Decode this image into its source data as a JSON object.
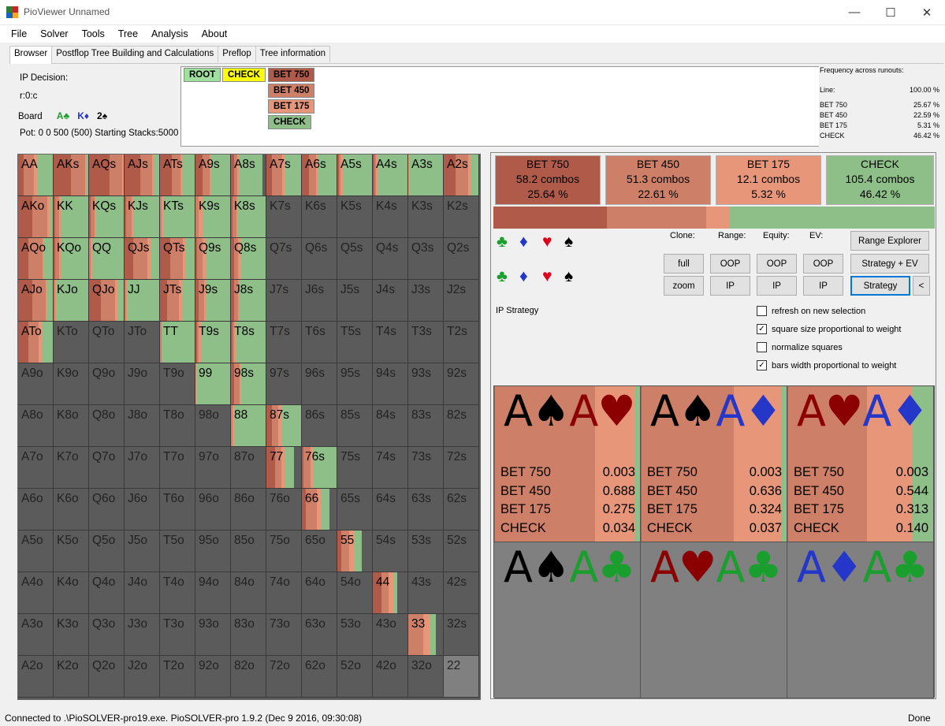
{
  "window": {
    "title": "PioViewer Unnamed"
  },
  "menu": [
    "File",
    "Solver",
    "Tools",
    "Tree",
    "Analysis",
    "About"
  ],
  "tabs": [
    "Browser",
    "Postflop Tree Building and Calculations",
    "Preflop",
    "Tree information"
  ],
  "info": {
    "decision": "IP Decision:",
    "node": "r:0:c",
    "board_label": "Board",
    "board": [
      {
        "text": "A♣",
        "color": "#1a9e2e"
      },
      {
        "text": "K♦",
        "color": "#2437c9"
      },
      {
        "text": "2♠",
        "color": "#000000"
      }
    ],
    "pot": "Pot: 0 0 500 (500) Starting Stacks:5000"
  },
  "tree": {
    "root": "ROOT",
    "check": "CHECK",
    "actions": [
      "BET 750",
      "BET 450",
      "BET 175",
      "CHECK"
    ]
  },
  "freq_panel": {
    "title": "Frequency across runouts:",
    "line_label": "Line:",
    "line_value": "100.00 %",
    "rows": [
      {
        "label": "BET 750",
        "value": "25.67 %"
      },
      {
        "label": "BET 450",
        "value": "22.59 %"
      },
      {
        "label": "BET 175",
        "value": "5.31 %"
      },
      {
        "label": "CHECK",
        "value": "46.42 %"
      }
    ]
  },
  "colors": {
    "bet750": "#b05a4a",
    "bet450": "#cd7f68",
    "bet175": "#e8967a",
    "check": "#8fbf88",
    "dead": "#5b5b5b",
    "dead2": "#808080"
  },
  "hands": [
    [
      "AA",
      "AKs",
      "AQs",
      "AJs",
      "ATs",
      "A9s",
      "A8s",
      "A7s",
      "A6s",
      "A5s",
      "A4s",
      "A3s",
      "A2s"
    ],
    [
      "AKo",
      "KK",
      "KQs",
      "KJs",
      "KTs",
      "K9s",
      "K8s",
      "K7s",
      "K6s",
      "K5s",
      "K4s",
      "K3s",
      "K2s"
    ],
    [
      "AQo",
      "KQo",
      "QQ",
      "QJs",
      "QTs",
      "Q9s",
      "Q8s",
      "Q7s",
      "Q6s",
      "Q5s",
      "Q4s",
      "Q3s",
      "Q2s"
    ],
    [
      "AJo",
      "KJo",
      "QJo",
      "JJ",
      "JTs",
      "J9s",
      "J8s",
      "J7s",
      "J6s",
      "J5s",
      "J4s",
      "J3s",
      "J2s"
    ],
    [
      "ATo",
      "KTo",
      "QTo",
      "JTo",
      "TT",
      "T9s",
      "T8s",
      "T7s",
      "T6s",
      "T5s",
      "T4s",
      "T3s",
      "T2s"
    ],
    [
      "A9o",
      "K9o",
      "Q9o",
      "J9o",
      "T9o",
      "99",
      "98s",
      "97s",
      "96s",
      "95s",
      "94s",
      "93s",
      "92s"
    ],
    [
      "A8o",
      "K8o",
      "Q8o",
      "J8o",
      "T8o",
      "98o",
      "88",
      "87s",
      "86s",
      "85s",
      "84s",
      "83s",
      "82s"
    ],
    [
      "A7o",
      "K7o",
      "Q7o",
      "J7o",
      "T7o",
      "97o",
      "87o",
      "77",
      "76s",
      "75s",
      "74s",
      "73s",
      "72s"
    ],
    [
      "A6o",
      "K6o",
      "Q6o",
      "J6o",
      "T6o",
      "96o",
      "86o",
      "76o",
      "66",
      "65s",
      "64s",
      "63s",
      "62s"
    ],
    [
      "A5o",
      "K5o",
      "Q5o",
      "J5o",
      "T5o",
      "95o",
      "85o",
      "75o",
      "65o",
      "55",
      "54s",
      "53s",
      "52s"
    ],
    [
      "A4o",
      "K4o",
      "Q4o",
      "J4o",
      "T4o",
      "94o",
      "84o",
      "74o",
      "64o",
      "54o",
      "44",
      "43s",
      "42s"
    ],
    [
      "A3o",
      "K3o",
      "Q3o",
      "J3o",
      "T3o",
      "93o",
      "83o",
      "73o",
      "63o",
      "53o",
      "43o",
      "33",
      "32s"
    ],
    [
      "A2o",
      "K2o",
      "Q2o",
      "J2o",
      "T2o",
      "92o",
      "82o",
      "72o",
      "62o",
      "52o",
      "42o",
      "32o",
      "22"
    ]
  ],
  "hand_strategy": {
    "AA": [
      0.15,
      0.3,
      0.1,
      0.45
    ],
    "AKs": [
      0.5,
      0.4,
      0.05,
      0.05
    ],
    "AQs": [
      0.6,
      0.35,
      0.05,
      0.0
    ],
    "AJs": [
      0.45,
      0.35,
      0.05,
      0.15
    ],
    "ATs": [
      0.35,
      0.25,
      0.05,
      0.35
    ],
    "A9s": [
      0.2,
      0.2,
      0.05,
      0.55
    ],
    "A8s": [
      0.1,
      0.1,
      0.05,
      0.75
    ],
    "A7s": [
      0.15,
      0.3,
      0.1,
      0.45
    ],
    "A6s": [
      0.2,
      0.2,
      0.05,
      0.55
    ],
    "A5s": [
      0.05,
      0.05,
      0.05,
      0.85
    ],
    "A4s": [
      0.05,
      0.05,
      0.05,
      0.85
    ],
    "A3s": [
      0.0,
      0.0,
      0.05,
      0.95
    ],
    "A2s": [
      0.35,
      0.35,
      0.1,
      0.2
    ],
    "AKo": [
      0.4,
      0.45,
      0.05,
      0.1
    ],
    "KK": [
      0.05,
      0.1,
      0.05,
      0.8
    ],
    "KQs": [
      0.05,
      0.1,
      0.05,
      0.8
    ],
    "KJs": [
      0.05,
      0.15,
      0.05,
      0.75
    ],
    "KTs": [
      0.0,
      0.05,
      0.05,
      0.9
    ],
    "K9s": [
      0.0,
      0.1,
      0.1,
      0.8
    ],
    "K8s": [
      0.05,
      0.1,
      0.05,
      0.8
    ],
    "AQo": [
      0.3,
      0.4,
      0.05,
      0.25
    ],
    "KQo": [
      0.05,
      0.1,
      0.05,
      0.8
    ],
    "QQ": [
      0.0,
      0.05,
      0.05,
      0.9
    ],
    "QJs": [
      0.25,
      0.4,
      0.1,
      0.25
    ],
    "QTs": [
      0.3,
      0.35,
      0.1,
      0.25
    ],
    "Q9s": [
      0.05,
      0.15,
      0.1,
      0.7
    ],
    "Q8s": [
      0.1,
      0.1,
      0.1,
      0.7
    ],
    "AJo": [
      0.4,
      0.4,
      0.05,
      0.15
    ],
    "KJo": [
      0.0,
      0.05,
      0.05,
      0.9
    ],
    "QJo": [
      0.35,
      0.4,
      0.1,
      0.15
    ],
    "JJ": [
      0.0,
      0.05,
      0.05,
      0.9
    ],
    "JTs": [
      0.2,
      0.35,
      0.1,
      0.35
    ],
    "J9s": [
      0.1,
      0.15,
      0.05,
      0.7
    ],
    "J8s": [
      0.1,
      0.1,
      0.05,
      0.75
    ],
    "ATo": [
      0.3,
      0.3,
      0.1,
      0.3
    ],
    "TT": [
      0.0,
      0.05,
      0.0,
      0.95
    ],
    "T9s": [
      0.05,
      0.05,
      0.05,
      0.85
    ],
    "T8s": [
      0.05,
      0.05,
      0.05,
      0.85
    ],
    "99": [
      0.0,
      0.0,
      0.05,
      0.95
    ],
    "98s": [
      0.1,
      0.15,
      0.05,
      0.7
    ],
    "88": [
      0.0,
      0.05,
      0.05,
      0.9
    ],
    "87s": [
      0.15,
      0.2,
      0.1,
      0.55
    ],
    "77": [
      0.3,
      0.25,
      0.1,
      0.35
    ],
    "76s": [
      0.05,
      0.2,
      0.1,
      0.65
    ],
    "66": [
      0.15,
      0.4,
      0.15,
      0.3
    ],
    "55": [
      0.15,
      0.35,
      0.2,
      0.3
    ],
    "44": [
      0.35,
      0.3,
      0.2,
      0.15
    ],
    "33": [
      0.0,
      0.55,
      0.25,
      0.2
    ]
  },
  "hand_width": {
    "A8s": 0.9,
    "K7s": 0,
    "K6s": 0,
    "K5s": 0,
    "K4s": 0,
    "K3s": 0,
    "K2s": 0,
    "99": 1.0,
    "98s": 1.0,
    "88": 1.0,
    "87s": 1.0,
    "77": 0.8,
    "76s": 1.0,
    "66": 0.8,
    "55": 0.7,
    "44": 0.7,
    "33": 0.8
  },
  "right": {
    "actions": [
      {
        "label": "BET 750",
        "combos": "58.2 combos",
        "pct": "25.64 %",
        "freq": 25.64,
        "color": "#b05a4a"
      },
      {
        "label": "BET 450",
        "combos": "51.3 combos",
        "pct": "22.61 %",
        "freq": 22.61,
        "color": "#cd7f68"
      },
      {
        "label": "BET 175",
        "combos": "12.1 combos",
        "pct": "5.32 %",
        "freq": 5.32,
        "color": "#e8967a"
      },
      {
        "label": "CHECK",
        "combos": "105.4 combos",
        "pct": "46.42 %",
        "freq": 46.42,
        "color": "#8fbf88"
      }
    ],
    "suits": [
      "♣",
      "♦",
      "♥",
      "♠"
    ],
    "labels": {
      "clone": "Clone:",
      "range": "Range:",
      "equity": "Equity:",
      "ev": "EV:",
      "strategy": "IP Strategy"
    },
    "buttons": {
      "full": "full",
      "zoom": "zoom",
      "oop": "OOP",
      "ip": "IP",
      "range_explorer": "Range Explorer",
      "strategy_ev": "Strategy + EV",
      "strategy": "Strategy",
      "back": "<"
    },
    "checkboxes": [
      {
        "label": "refresh on new selection",
        "checked": false
      },
      {
        "label": "square size proportional to weight",
        "checked": true
      },
      {
        "label": "normalize squares",
        "checked": false
      },
      {
        "label": "bars width proportional to weight",
        "checked": true
      }
    ],
    "combos": [
      {
        "c1": {
          "r": "A",
          "s": "♠",
          "col": "#000000"
        },
        "c2": {
          "r": "A",
          "s": "♥",
          "col": "#8b0000"
        },
        "rows": [
          [
            "BET 750",
            "0.003"
          ],
          [
            "BET 450",
            "0.688"
          ],
          [
            "BET 175",
            "0.275"
          ],
          [
            "CHECK",
            "0.034"
          ]
        ]
      },
      {
        "c1": {
          "r": "A",
          "s": "♠",
          "col": "#000000"
        },
        "c2": {
          "r": "A",
          "s": "♦",
          "col": "#2437c9"
        },
        "rows": [
          [
            "BET 750",
            "0.003"
          ],
          [
            "BET 450",
            "0.636"
          ],
          [
            "BET 175",
            "0.324"
          ],
          [
            "CHECK",
            "0.037"
          ]
        ]
      },
      {
        "c1": {
          "r": "A",
          "s": "♥",
          "col": "#8b0000"
        },
        "c2": {
          "r": "A",
          "s": "♦",
          "col": "#2437c9"
        },
        "rows": [
          [
            "BET 750",
            "0.003"
          ],
          [
            "BET 450",
            "0.544"
          ],
          [
            "BET 175",
            "0.313"
          ],
          [
            "CHECK",
            "0.140"
          ]
        ]
      },
      {
        "c1": {
          "r": "A",
          "s": "♠",
          "col": "#000000"
        },
        "c2": {
          "r": "A",
          "s": "♣",
          "col": "#1a9e2e"
        }
      },
      {
        "c1": {
          "r": "A",
          "s": "♥",
          "col": "#8b0000"
        },
        "c2": {
          "r": "A",
          "s": "♣",
          "col": "#1a9e2e"
        }
      },
      {
        "c1": {
          "r": "A",
          "s": "♦",
          "col": "#2437c9"
        },
        "c2": {
          "r": "A",
          "s": "♣",
          "col": "#1a9e2e"
        }
      }
    ]
  },
  "status": {
    "left": "Connected to .\\PioSOLVER-pro19.exe. PioSOLVER-pro 1.9.2 (Dec  9 2016, 09:30:08)",
    "right": "Done"
  }
}
